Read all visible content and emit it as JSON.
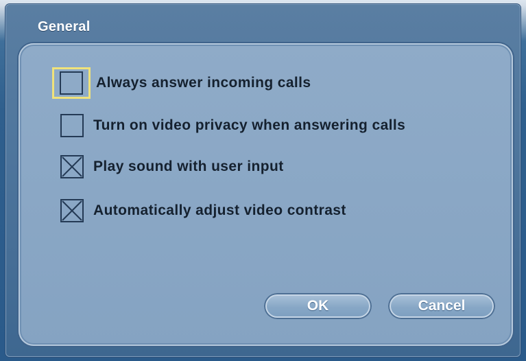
{
  "window": {
    "title": "General"
  },
  "options": [
    {
      "label": "Always answer incoming calls",
      "checked": false,
      "focused": true
    },
    {
      "label": "Turn on video privacy when answering calls",
      "checked": false,
      "focused": false
    },
    {
      "label": "Play sound with user input",
      "checked": true,
      "focused": false
    },
    {
      "label": "Automatically adjust video contrast",
      "checked": true,
      "focused": false
    }
  ],
  "buttons": {
    "ok": "OK",
    "cancel": "Cancel"
  },
  "colors": {
    "focus": "#f0e27a",
    "panel": "#8aa7c5",
    "window": "#4f769d"
  },
  "icons": {
    "check_mark": "x-cross-icon"
  }
}
